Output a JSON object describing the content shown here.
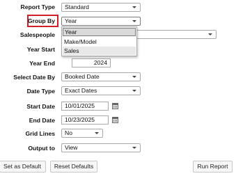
{
  "form": {
    "report_type": {
      "label": "Report Type",
      "value": "Standard"
    },
    "group_by": {
      "label": "Group By",
      "value": "Year",
      "options": [
        "Year",
        "Make/Model",
        "Sales"
      ]
    },
    "salespeople": {
      "label": "Salespeople",
      "value": ""
    },
    "year_start": {
      "label": "Year Start",
      "value": ""
    },
    "year_end": {
      "label": "Year End",
      "value": "2024"
    },
    "select_date_by": {
      "label": "Select Date By",
      "value": "Booked Date"
    },
    "date_type": {
      "label": "Date Type",
      "value": "Exact Dates"
    },
    "start_date": {
      "label": "Start Date",
      "value": "10/01/2025"
    },
    "end_date": {
      "label": "End Date",
      "value": "10/23/2025"
    },
    "grid_lines": {
      "label": "Grid Lines",
      "value": "No"
    },
    "output_to": {
      "label": "Output to",
      "value": "View"
    }
  },
  "buttons": {
    "set_default": "Set as Default",
    "reset_defaults": "Reset Defaults",
    "run_report": "Run Report"
  },
  "colors": {
    "highlight": "#d01f26",
    "dropdown_selected": "#d9d9d9"
  },
  "icons": {
    "date_picker": "calendar-icon",
    "select_caret": "chevron-down-icon"
  }
}
